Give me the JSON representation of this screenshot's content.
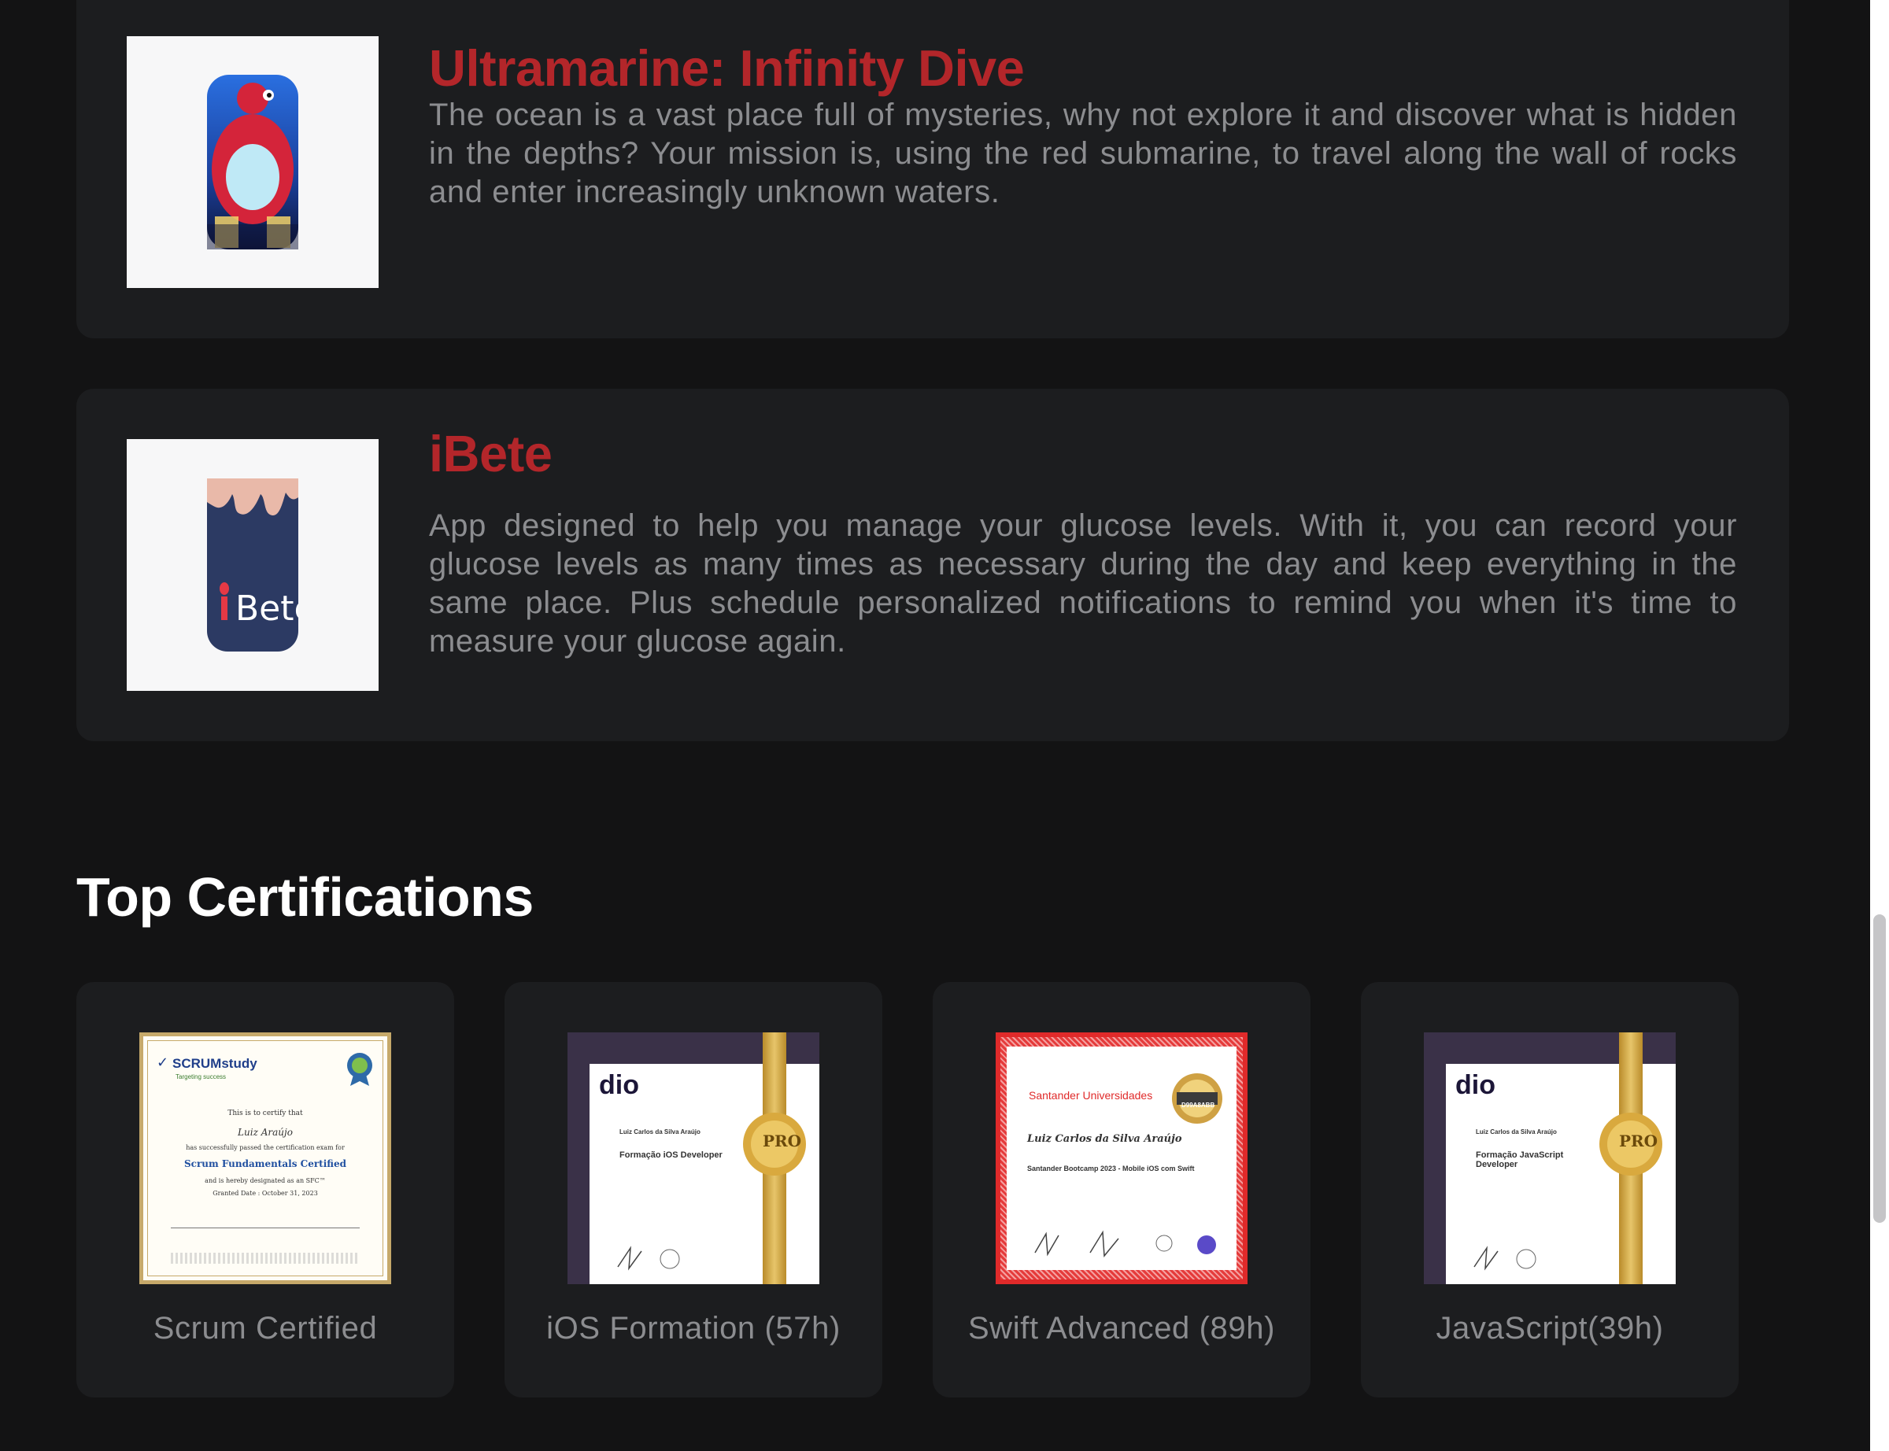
{
  "projects": [
    {
      "title": "Ultramarine: Infinity Dive",
      "description": "The ocean is a vast place full of mysteries, why not explore it and discover what is hidden in the depths? Your mission is, using the red submarine, to travel along the wall of rocks and enter increasingly unknown waters.",
      "icon": "submarine-app-icon"
    },
    {
      "title": "iBete",
      "description": "App designed to help you manage your glucose levels. With it, you can record your glucose levels as many times as necessary during the day and keep everything in the same place. Plus schedule personalized notifications to remind you when it's time to measure your glucose again.",
      "icon": "ibete-app-icon",
      "icon_text": "Bete"
    }
  ],
  "certifications": {
    "title": "Top Certifications",
    "items": [
      {
        "label": "Scrum Certified",
        "cert_brand": "SCRUMstudy",
        "cert_tagline": "Targeting success",
        "cert_line1": "This is to certify that",
        "cert_name": "Luiz Araújo",
        "cert_line2": "has successfully passed the certification exam for",
        "cert_course": "Scrum Fundamentals Certified",
        "cert_line3": "and is hereby designated as an SFC™",
        "cert_date": "Granted Date : October 31, 2023"
      },
      {
        "label": "iOS Formation (57h)",
        "cert_brand": "dio",
        "cert_name": "Luiz Carlos da Silva Araújo",
        "cert_course": "Formação iOS Developer",
        "cert_seal": "PRO"
      },
      {
        "label": "Swift Advanced (89h)",
        "cert_brand": "Santander Universidades",
        "cert_code": "D99A8ABB",
        "cert_name": "Luiz Carlos da Silva Araújo",
        "cert_course": "Santander Bootcamp 2023 - Mobile iOS com Swift"
      },
      {
        "label": "JavaScript(39h)",
        "cert_brand": "dio",
        "cert_name": "Luiz Carlos da Silva Araújo",
        "cert_course": "Formação JavaScript Developer",
        "cert_seal": "PRO"
      }
    ]
  },
  "colors": {
    "background": "#131314",
    "card": "#1c1d1f",
    "accent_title": "#b3262a",
    "muted_text": "#8c8d90",
    "heading": "#ffffff"
  }
}
